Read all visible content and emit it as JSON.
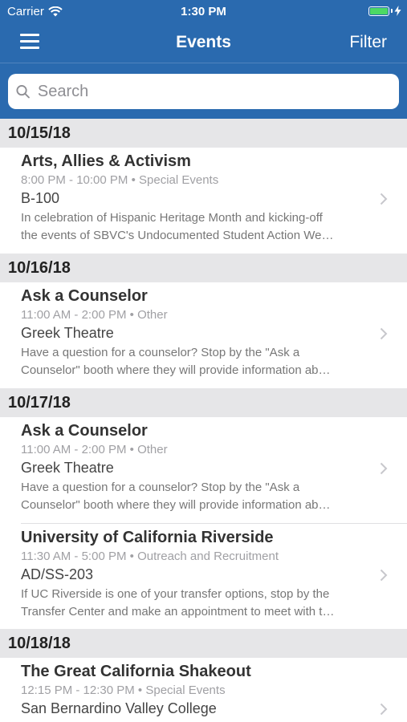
{
  "status_bar": {
    "carrier": "Carrier",
    "time": "1:30 PM"
  },
  "nav": {
    "title": "Events",
    "filter_label": "Filter"
  },
  "search": {
    "placeholder": "Search"
  },
  "sections": [
    {
      "date": "10/15/18",
      "events": [
        {
          "title": "Arts, Allies & Activism",
          "time": "8:00 PM - 10:00 PM",
          "category": "Special Events",
          "location": "B-100",
          "desc_line1": "In celebration of Hispanic Heritage Month and kicking-off",
          "desc_line2": "the events of SBVC's Undocumented Student Action We…"
        }
      ]
    },
    {
      "date": "10/16/18",
      "events": [
        {
          "title": "Ask a Counselor",
          "time": "11:00 AM - 2:00 PM",
          "category": "Other",
          "location": "Greek Theatre",
          "desc_line1": "Have a question for a counselor? Stop by the \"Ask a",
          "desc_line2": "Counselor\" booth where they will provide information ab…"
        }
      ]
    },
    {
      "date": "10/17/18",
      "events": [
        {
          "title": "Ask a Counselor",
          "time": "11:00 AM - 2:00 PM",
          "category": "Other",
          "location": "Greek Theatre",
          "desc_line1": "Have a question for a counselor? Stop by the \"Ask a",
          "desc_line2": "Counselor\" booth where they will provide information ab…"
        },
        {
          "title": "University of California Riverside",
          "time": "11:30 AM - 5:00 PM",
          "category": "Outreach and Recruitment",
          "location": "AD/SS-203",
          "desc_line1": "If UC Riverside is one of your transfer options, stop by the",
          "desc_line2": "Transfer Center and make an appointment to meet with t…"
        }
      ]
    },
    {
      "date": "10/18/18",
      "events": [
        {
          "title": "The Great California Shakeout",
          "time": "12:15 PM - 12:30 PM",
          "category": "Special Events",
          "location": "San Bernardino Valley College"
        }
      ]
    }
  ],
  "colors": {
    "header_bg": "#2a6aaf",
    "section_bg": "#e6e6e8",
    "battery": "#4cd964"
  }
}
